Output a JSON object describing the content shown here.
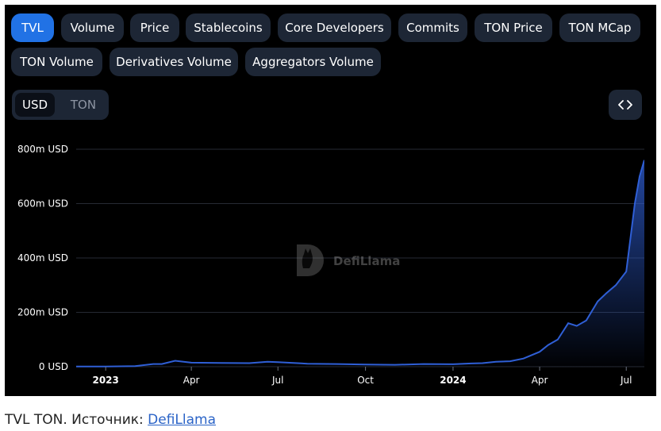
{
  "tabs": [
    "TVL",
    "Volume",
    "Price",
    "Stablecoins",
    "Core Developers",
    "Commits",
    "TON Price",
    "TON MCap",
    "TON Volume",
    "Derivatives Volume",
    "Aggregators Volume"
  ],
  "active_tab": "TVL",
  "currency_toggle": {
    "options": [
      "USD",
      "TON"
    ],
    "selected": "USD"
  },
  "embed_icon": "code-brackets-icon",
  "watermark": {
    "text": "DefiLlama",
    "icon": "llama-logo-icon"
  },
  "caption": {
    "text": "TVL TON. Источник: ",
    "link": "DefiLlama"
  },
  "colors": {
    "accent": "#2172e5",
    "line": "#2f5fd6",
    "background": "#000000",
    "button": "#1d2635"
  },
  "chart_data": {
    "type": "area",
    "x_unit": "date",
    "y_unit": "USD",
    "x": [
      "2022-12-01",
      "2023-01-01",
      "2023-02-01",
      "2023-02-20",
      "2023-03-01",
      "2023-03-15",
      "2023-04-01",
      "2023-05-01",
      "2023-06-01",
      "2023-06-20",
      "2023-07-01",
      "2023-08-01",
      "2023-09-01",
      "2023-10-01",
      "2023-11-01",
      "2023-12-01",
      "2024-01-01",
      "2024-01-20",
      "2024-02-01",
      "2024-02-15",
      "2024-03-01",
      "2024-03-15",
      "2024-04-01",
      "2024-04-10",
      "2024-04-20",
      "2024-05-01",
      "2024-05-10",
      "2024-05-20",
      "2024-06-01",
      "2024-06-10",
      "2024-06-20",
      "2024-07-01",
      "2024-07-10",
      "2024-07-15",
      "2024-07-20"
    ],
    "y": [
      1,
      1,
      2,
      10,
      10,
      22,
      15,
      14,
      13,
      18,
      17,
      11,
      10,
      8,
      7,
      10,
      9,
      12,
      13,
      18,
      20,
      30,
      55,
      80,
      100,
      160,
      150,
      170,
      240,
      270,
      300,
      350,
      600,
      700,
      760
    ],
    "x_ticks": [
      "2023",
      "Apr",
      "Jul",
      "Oct",
      "2024",
      "Apr",
      "Jul"
    ],
    "x_tick_dates": [
      "2023-01-01",
      "2023-04-01",
      "2023-07-01",
      "2023-10-01",
      "2024-01-01",
      "2024-04-01",
      "2024-07-01"
    ],
    "y_ticks": [
      "0 USD",
      "200m USD",
      "400m USD",
      "600m USD",
      "800m USD"
    ],
    "y_tick_values": [
      0,
      200,
      400,
      600,
      800
    ],
    "ylim": [
      0,
      800
    ],
    "grid": true
  }
}
